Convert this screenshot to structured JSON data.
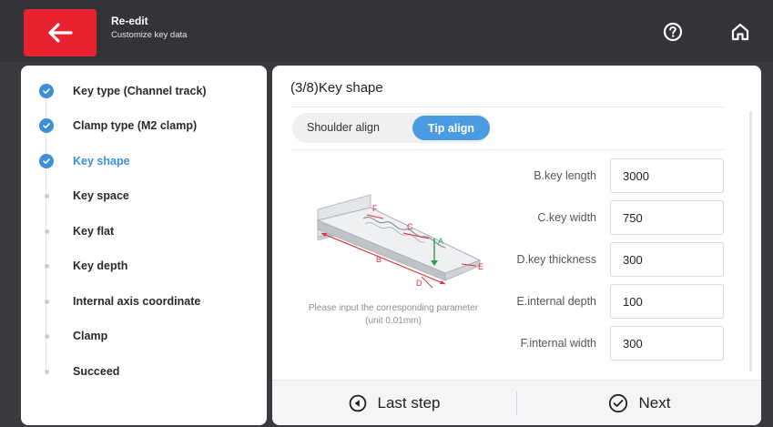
{
  "header": {
    "title": "Re-edit",
    "subtitle": "Customize key data",
    "back_icon": "arrow-left-icon",
    "help_icon": "question-circle-icon",
    "home_icon": "home-icon",
    "accent_color": "#e8232f"
  },
  "steps": [
    {
      "label": "Key type (Channel track)",
      "state": "done"
    },
    {
      "label": "Clamp type (M2 clamp)",
      "state": "done"
    },
    {
      "label": "Key shape",
      "state": "current"
    },
    {
      "label": "Key space",
      "state": "pending"
    },
    {
      "label": "Key flat",
      "state": "pending"
    },
    {
      "label": "Key depth",
      "state": "pending"
    },
    {
      "label": "Internal axis coordinate",
      "state": "pending"
    },
    {
      "label": "Clamp",
      "state": "pending"
    },
    {
      "label": "Succeed",
      "state": "pending"
    }
  ],
  "main": {
    "title": "(3/8)Key shape",
    "align_options": [
      "Shoulder align",
      "Tip align"
    ],
    "selected_align": "Tip align",
    "hint": "Please input the corresponding parameter (unit 0.01mm)",
    "diagram_letters": [
      "A",
      "B",
      "C",
      "D",
      "E",
      "F"
    ],
    "params": [
      {
        "label": "B.key length",
        "value": "3000"
      },
      {
        "label": "C.key width",
        "value": "750"
      },
      {
        "label": "D.key thickness",
        "value": "300"
      },
      {
        "label": "E.internal depth",
        "value": "100"
      },
      {
        "label": "F.internal width",
        "value": "300"
      }
    ]
  },
  "footer": {
    "last_step_label": "Last step",
    "next_label": "Next"
  },
  "colors": {
    "active_blue": "#3d8ed6",
    "segment_blue": "#4a9be0",
    "diagram_red": "#d9323a",
    "diagram_green": "#2e9e4a"
  }
}
